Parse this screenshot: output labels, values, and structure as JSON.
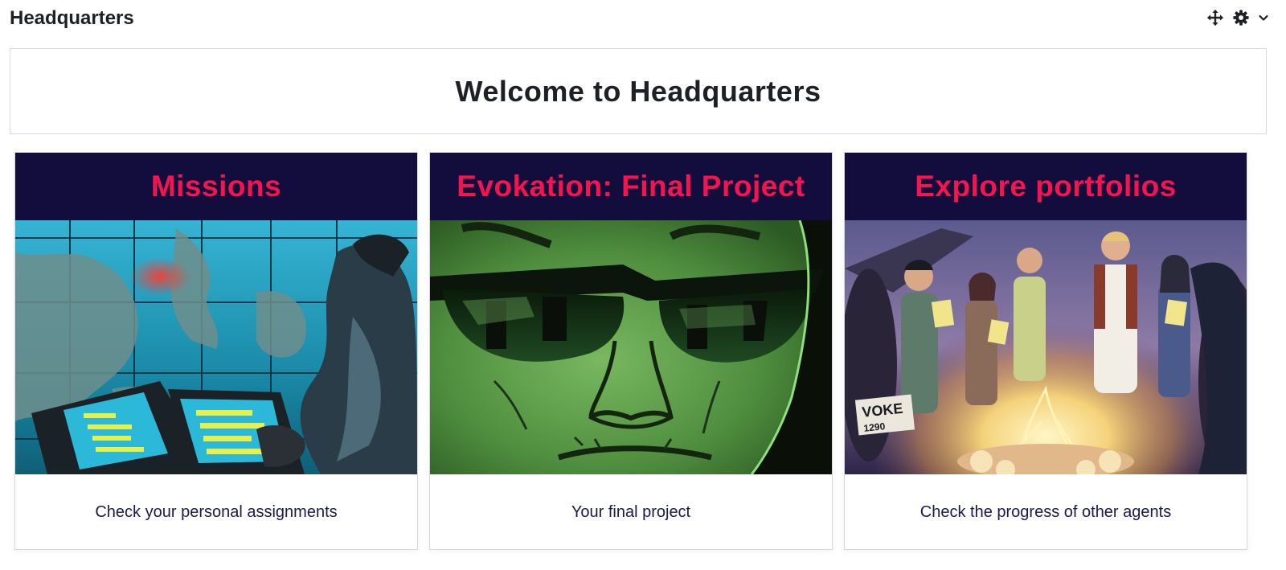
{
  "block": {
    "title": "Headquarters",
    "controls": {
      "move_icon": "move-arrows-icon",
      "settings_icon": "gear-icon",
      "menu_icon": "chevron-down-icon"
    }
  },
  "welcome": {
    "heading": "Welcome to Headquarters"
  },
  "theme": {
    "card_header_bg": "#130d3e",
    "card_title_color": "#f5144f",
    "description_color": "#1b1a4a"
  },
  "cards": [
    {
      "title": "Missions",
      "image": "comic-agent-world-map-illustration",
      "description": "Check your personal assignments"
    },
    {
      "title": "Evokation: Final Project",
      "image": "comic-sunglasses-face-illustration",
      "description": "Your final project"
    },
    {
      "title": "Explore portfolios",
      "image": "comic-agents-campfire-illustration",
      "description": "Check the progress of other agents"
    }
  ]
}
